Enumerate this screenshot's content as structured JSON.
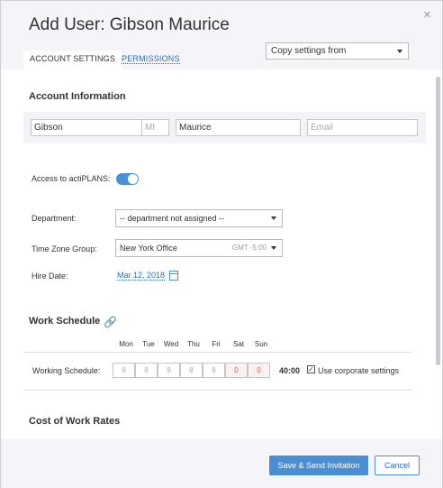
{
  "dialog": {
    "title": "Add User: Gibson Maurice",
    "close_glyph": "×"
  },
  "tabs": [
    {
      "label": "ACCOUNT SETTINGS",
      "active": true
    },
    {
      "label": "PERMISSIONS",
      "active": false
    }
  ],
  "copy_settings": {
    "label": "Copy settings from"
  },
  "account_info": {
    "title": "Account Information",
    "first_name": "Gibson",
    "middle_initial_placeholder": "MI",
    "last_name": "Maurice",
    "email_placeholder": "Email"
  },
  "access": {
    "label": "Access to actiPLANS:",
    "enabled": true
  },
  "department": {
    "label": "Department:",
    "value": "-- department not assigned --"
  },
  "time_zone": {
    "label": "Time Zone Group:",
    "value": "New York Office",
    "offset": "GMT -5:00"
  },
  "hire_date": {
    "label": "Hire Date:",
    "value": "Mar 12, 2018"
  },
  "work_schedule": {
    "title": "Work Schedule",
    "days": [
      "Mon",
      "Tue",
      "Wed",
      "Thu",
      "Fri",
      "Sat",
      "Sun"
    ],
    "row_label": "Working Schedule:",
    "hours": [
      "8",
      "8",
      "8",
      "8",
      "8",
      "0",
      "0"
    ],
    "total": "40:00",
    "corporate_label": "Use corporate settings",
    "corporate_checked": true
  },
  "cost_rates": {
    "title": "Cost of Work Rates"
  },
  "footer": {
    "save_label": "Save & Send Invitation",
    "cancel_label": "Cancel"
  },
  "colors": {
    "accent": "#4a8fd4",
    "link": "#2a6ebb",
    "weekend": "#d9534f"
  },
  "icons": [
    "close-icon",
    "chevron-down-icon",
    "calendar-icon",
    "link-icon",
    "checkmark-icon"
  ]
}
